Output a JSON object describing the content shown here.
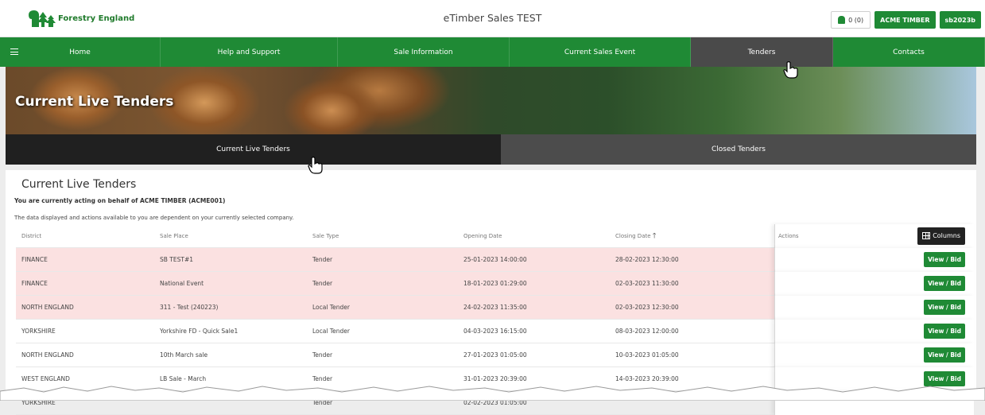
{
  "header": {
    "logo_text": "Forestry England",
    "app_title": "eTimber Sales TEST",
    "notifications": "0 (0)",
    "company_button": "ACME TIMBER",
    "user_button": "sb2023b"
  },
  "nav": {
    "items": [
      {
        "label": "Home"
      },
      {
        "label": "Help and Support"
      },
      {
        "label": "Sale Information"
      },
      {
        "label": "Current Sales Event"
      },
      {
        "label": "Tenders"
      },
      {
        "label": "Contacts"
      }
    ]
  },
  "banner": {
    "title": "Current Live Tenders"
  },
  "subtabs": {
    "live": "Current Live Tenders",
    "closed": "Closed Tenders"
  },
  "content": {
    "title": "Current Live Tenders",
    "acting": "You are currently acting on behalf of ACME TIMBER (ACME001)",
    "note": "The data displayed and actions available to you are dependent on your currently selected company."
  },
  "table": {
    "headers": [
      "District",
      "Sale Place",
      "Sale Type",
      "Opening Date",
      "Closing Date",
      "Actions"
    ],
    "sort_arrow": "🡑",
    "columns_button": "Columns",
    "view_label": "View / Bid",
    "rows": [
      {
        "district": "FINANCE",
        "place": "SB TEST#1",
        "type": "Tender",
        "open": "25-01-2023 14:00:00",
        "close": "28-02-2023 12:30:00",
        "highlight": true
      },
      {
        "district": "FINANCE",
        "place": "National Event",
        "type": "Tender",
        "open": "18-01-2023 01:29:00",
        "close": "02-03-2023 11:30:00",
        "highlight": true
      },
      {
        "district": "NORTH ENGLAND",
        "place": "311 - Test (240223)",
        "type": "Local Tender",
        "open": "24-02-2023 11:35:00",
        "close": "02-03-2023 12:30:00",
        "highlight": true
      },
      {
        "district": "YORKSHIRE",
        "place": "Yorkshire FD - Quick Sale1",
        "type": "Local Tender",
        "open": "04-03-2023 16:15:00",
        "close": "08-03-2023 12:00:00",
        "highlight": false
      },
      {
        "district": "NORTH ENGLAND",
        "place": "10th March sale",
        "type": "Tender",
        "open": "27-01-2023 01:05:00",
        "close": "10-03-2023 01:05:00",
        "highlight": false
      },
      {
        "district": "WEST ENGLAND",
        "place": "LB Sale - March",
        "type": "Tender",
        "open": "31-01-2023 20:39:00",
        "close": "14-03-2023 20:39:00",
        "highlight": false
      },
      {
        "district": "YORKSHIRE",
        "place": "",
        "type": "Tender",
        "open": "02-02-2023 01:05:00",
        "close": "",
        "highlight": false
      }
    ]
  },
  "colors": {
    "brand_green": "#1f8a35",
    "highlight_row": "#fbe1e1",
    "active_nav": "#4a4a4a"
  }
}
